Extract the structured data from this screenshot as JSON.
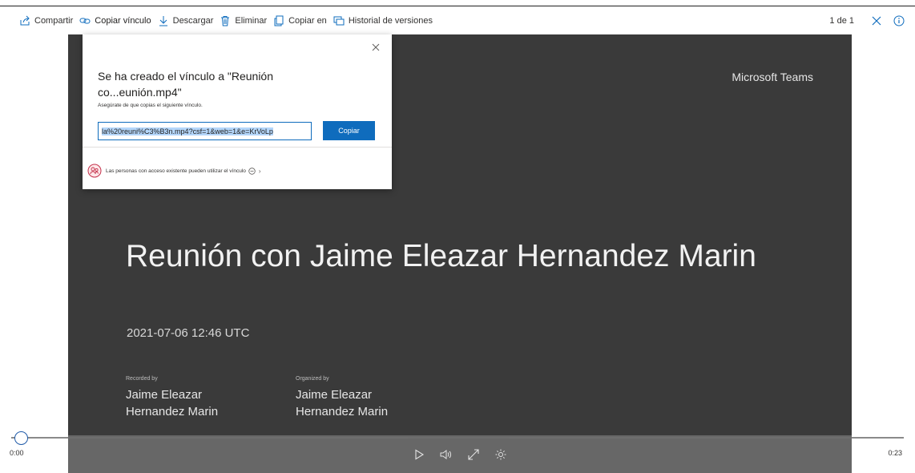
{
  "toolbar": {
    "items": [
      {
        "label": "Compartir",
        "icon": "share-icon"
      },
      {
        "label": "Copiar vínculo",
        "icon": "link-icon"
      },
      {
        "label": "Descargar",
        "icon": "download-icon"
      },
      {
        "label": "Eliminar",
        "icon": "trash-icon"
      },
      {
        "label": "Copiar en",
        "icon": "copy-icon"
      },
      {
        "label": "Historial de versiones",
        "icon": "history-icon"
      }
    ],
    "page_count": "1 de 1",
    "close_icon": "close-icon",
    "info_icon": "info-icon"
  },
  "dialog": {
    "title": "Se ha creado el vínculo a \"Reunión co...eunión.mp4\"",
    "subtitle": "Asegúrate de que copias el siguiente vínculo.",
    "link_value": "la%20reuni%C3%B3n.mp4?csf=1&web=1&e=KrVoLp",
    "copy_label": "Copiar",
    "access_text": "Las personas con acceso existente pueden utilizar el vínculo",
    "access_icon": "people-icon"
  },
  "slide": {
    "brand": "Microsoft Teams",
    "title": "Reunión con Jaime Eleazar Hernandez Marin",
    "datetime": "2021-07-06 12:46 UTC",
    "recorded_by_label": "Recorded by",
    "recorded_by_name": "Jaime Eleazar Hernandez Marin",
    "organizer_label": "Organized by",
    "organizer_name": "Jaime Eleazar Hernandez Marin"
  },
  "player": {
    "current_time": "0:00",
    "duration": "0:23",
    "progress": 0.0
  },
  "colors": {
    "accent": "#0f6cbd",
    "slide_bg": "#3a3a3a",
    "controls_bg": "#6b6b6b"
  }
}
